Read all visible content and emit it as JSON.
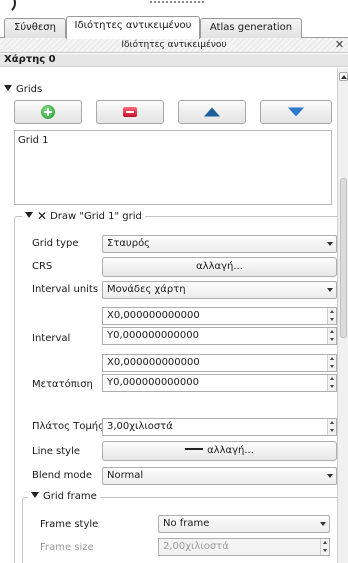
{
  "tabs": [
    {
      "label": "Σύνθεση"
    },
    {
      "label": "Ιδιότητες αντικειμένου"
    },
    {
      "label": "Atlas generation"
    }
  ],
  "dock": {
    "title": "Ιδιότητες αντικειμένου",
    "close_glyph": "✕"
  },
  "item": {
    "title": "Χάρτης 0"
  },
  "grids": {
    "section_label": "Grids",
    "toolbar": {
      "add_icon": "plus-icon",
      "remove_icon": "minus-icon",
      "up_icon": "arrow-up-icon",
      "down_icon": "arrow-down-icon"
    },
    "list_items": [
      "Grid 1"
    ]
  },
  "draw_grid": {
    "checked_glyph": "✕",
    "title": "Draw \"Grid 1\" grid",
    "grid_type": {
      "label": "Grid type",
      "value": "Σταυρός"
    },
    "crs": {
      "label": "CRS",
      "button": "αλλαγή..."
    },
    "interval_units": {
      "label": "Interval units",
      "value": "Μονάδες χάρτη"
    },
    "interval": {
      "label": "Interval",
      "x": "X0,000000000000",
      "y": "Y0,000000000000"
    },
    "offset": {
      "label": "Μετατόπιση",
      "x": "X0,000000000000",
      "y": "Y0,000000000000"
    },
    "cross_width": {
      "label": "Πλάτος Τομής",
      "value": "3,00χιλιοστά"
    },
    "line_style": {
      "label": "Line style",
      "button": "αλλαγή..."
    },
    "blend_mode": {
      "label": "Blend mode",
      "value": "Normal"
    },
    "grid_frame": {
      "title": "Grid frame",
      "frame_style": {
        "label": "Frame style",
        "value": "No frame"
      },
      "frame_size": {
        "label": "Frame size",
        "value": "2,00χιλιοστά"
      }
    }
  }
}
